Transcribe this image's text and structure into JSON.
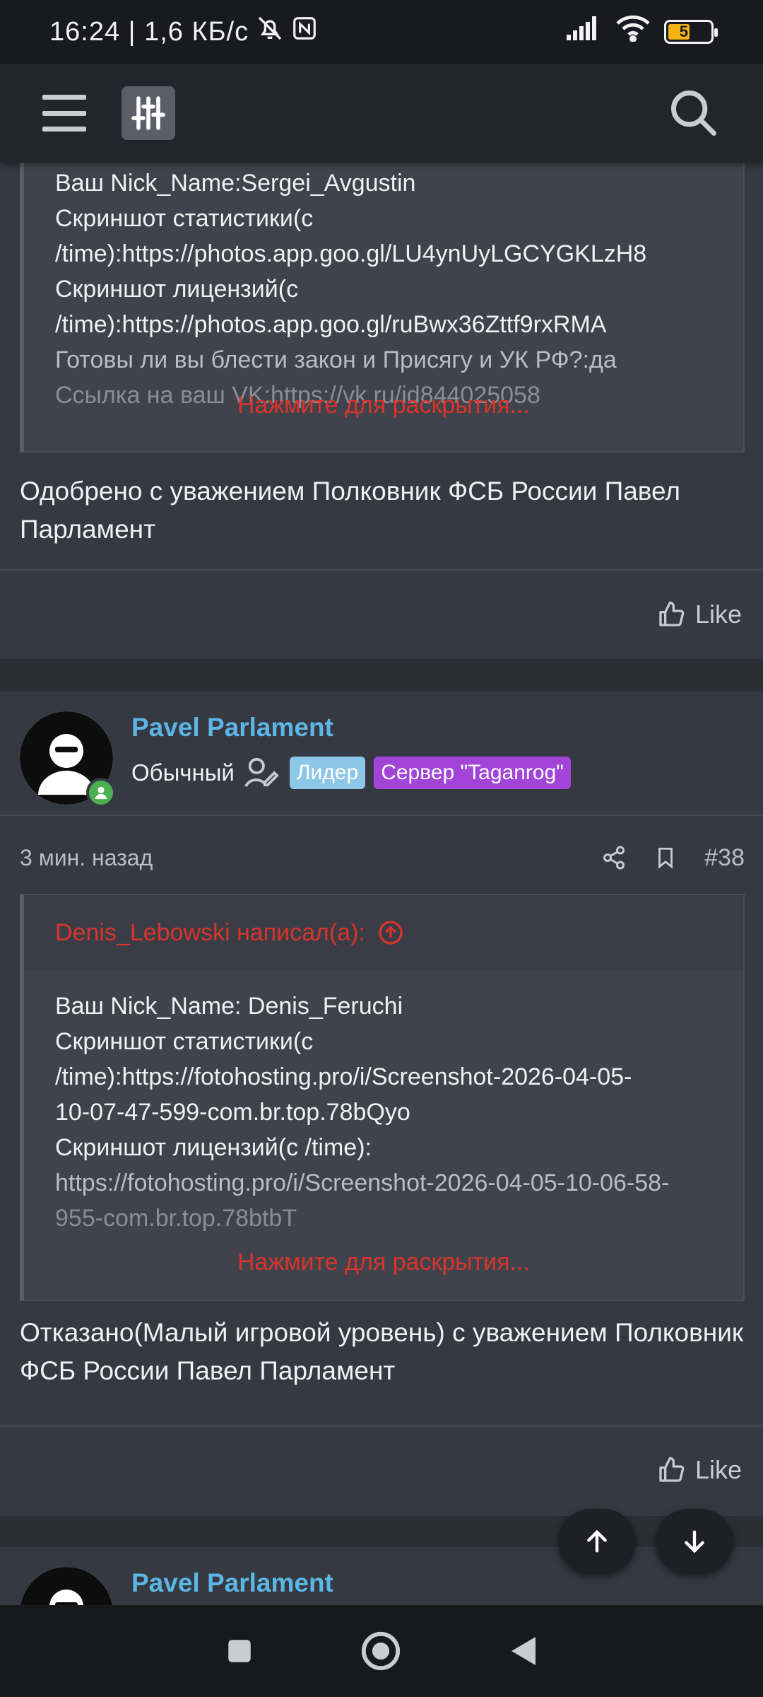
{
  "status_bar": {
    "time_speed": "16:24 | 1,6 КБ/с",
    "battery_level": "51",
    "battery_fraction": 0.51,
    "battery_color": "#f2b315"
  },
  "app_bar": {
    "menu_icon": "hamburger-icon",
    "filter_icon": "sliders-icon",
    "search_icon": "search-icon"
  },
  "post1": {
    "quote_lines": [
      "Ваш Nick_Name:Sergei_Avgustin",
      "Скриншот статистики(с",
      "/time):https://photos.app.goo.gl/LU4ynUyLGCYGKLzH8",
      "Скриншот лицензий(с",
      "/time):https://photos.app.goo.gl/ruBwx36Zttf9rxRMA",
      "Готовы ли вы блести закон и Присягу и УК РФ?:да",
      "Ссылка на ваш VK:https://vk.ru/id844025058"
    ],
    "expand_label": "Нажмите для раскрытия...",
    "text": "Одобрено с уважением Полковник ФСБ России Павел Парламент",
    "like_label": "Like"
  },
  "post2": {
    "username": "Pavel Parlament",
    "user_title": "Обычный",
    "badge_leader": "Лидер",
    "badge_server": "Сервер \"Taganrog\"",
    "time": "3 мин. назад",
    "post_number": "#38",
    "quote_author": "Denis_Lebowski написал(а):",
    "quote_lines": [
      "Ваш Nick_Name: Denis_Feruchi",
      "Скриншот статистики(с",
      "/time):https://fotohosting.pro/i/Screenshot-2026-04-05-",
      "10-07-47-599-com.br.top.78bQyo",
      "Скриншот лицензий(с /time):",
      "https://fotohosting.pro/i/Screenshot-2026-04-05-10-06-58-",
      "955-com.br.top.78btbT"
    ],
    "expand_label": "Нажмите для раскрытия...",
    "text": "Отказано(Малый игровой уровень) с уважением Полковник ФСБ России Павел Парламент",
    "like_label": "Like"
  },
  "post3": {
    "username": "Pavel Parlament"
  },
  "colors": {
    "link_blue": "#5cb5e4",
    "quote_red": "#d8342b",
    "badge_leader": "#8cc7e7",
    "badge_server": "#a344d8",
    "online_green": "#4caf50"
  }
}
